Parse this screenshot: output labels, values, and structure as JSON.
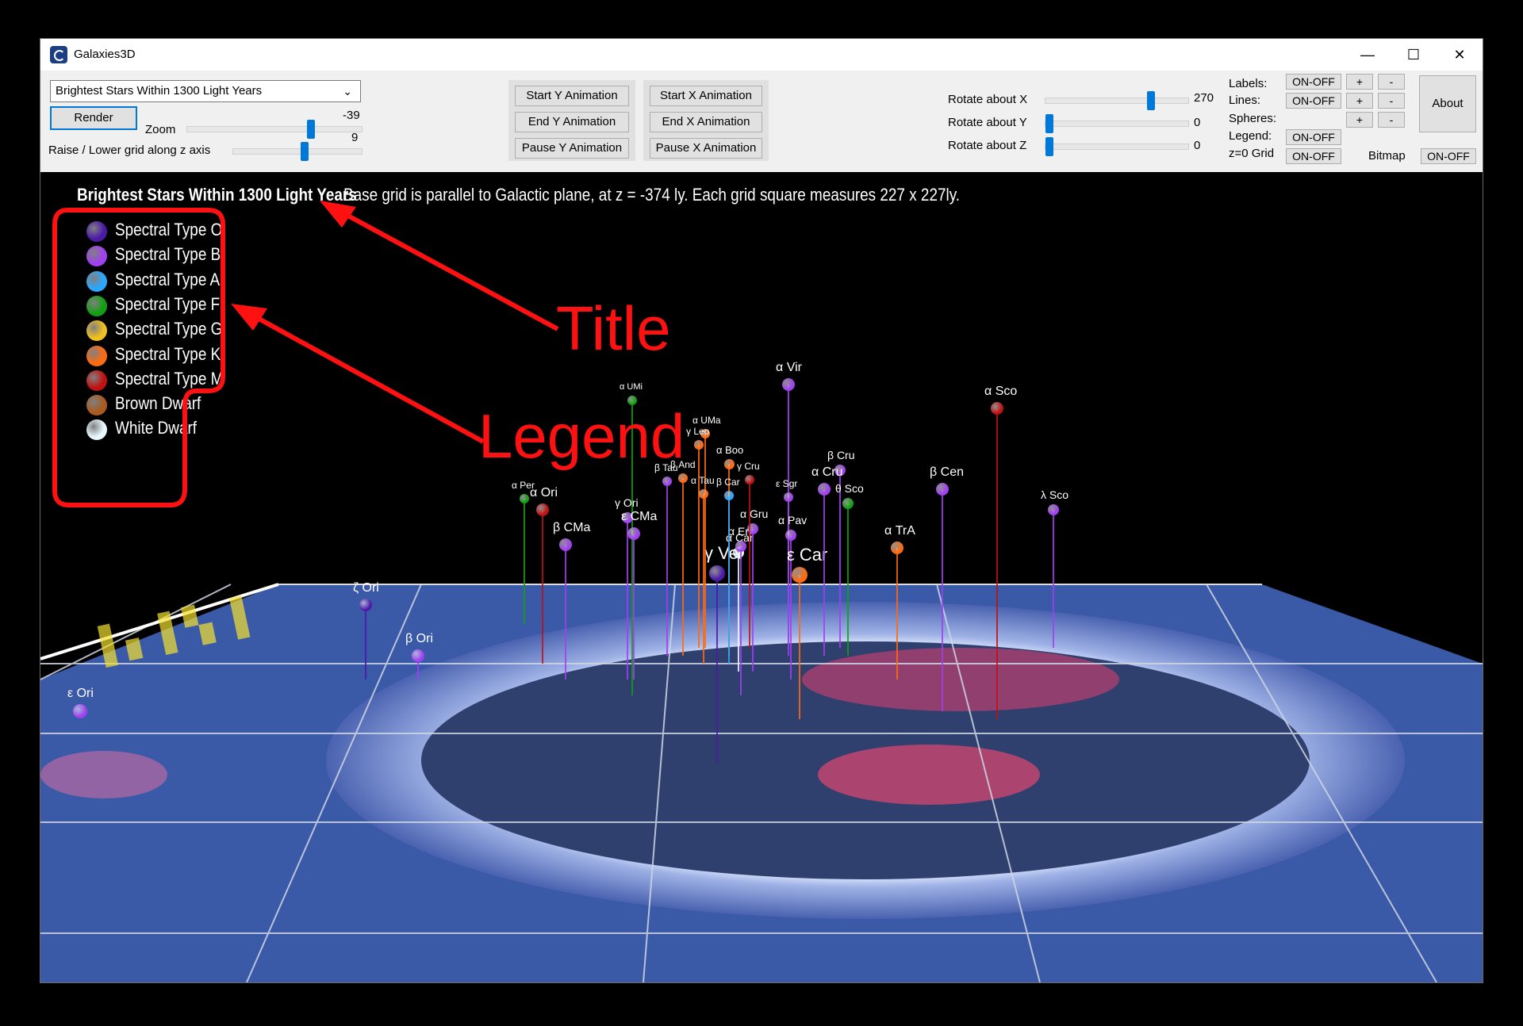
{
  "window": {
    "title": "Galaxies3D",
    "minimize": "—",
    "maximize": "☐",
    "close": "✕"
  },
  "toolbar": {
    "dataset": "Brightest Stars Within 1300 Light Years",
    "render": "Render",
    "zoom_label": "Zoom",
    "zoom_value": "-39",
    "zoom_fraction": 0.72,
    "grid_label": "Raise / Lower grid along z axis",
    "grid_value": "9",
    "grid_fraction": 0.56,
    "y_anim": [
      "Start Y Animation",
      "End Y Animation",
      "Pause Y Animation"
    ],
    "x_anim": [
      "Start X Animation",
      "End X Animation",
      "Pause X Animation"
    ],
    "rotate": [
      {
        "label": "Rotate about X",
        "value": "270",
        "fraction": 0.75
      },
      {
        "label": "Rotate about Y",
        "value": "0",
        "fraction": 0.0
      },
      {
        "label": "Rotate about Z",
        "value": "0",
        "fraction": 0.0
      }
    ],
    "labels_label": "Labels:",
    "lines_label": "Lines:",
    "spheres_label": "Spheres:",
    "legend_label": "Legend:",
    "grid0_label": "z=0 Grid",
    "bitmap_label": "Bitmap",
    "on_off": "ON-OFF",
    "plus": "+",
    "minus": "-",
    "about": "About"
  },
  "scene": {
    "title": "Brightest Stars Within 1300 Light Years",
    "description": "Base grid is parallel to Galactic plane, at z = -374 ly. Each grid square measures 227 x 227ly.",
    "legend": [
      {
        "label": "Spectral Type O",
        "color": "#4b1aa8"
      },
      {
        "label": "Spectral Type B",
        "color": "#a040f0"
      },
      {
        "label": "Spectral Type A",
        "color": "#2aa8ff"
      },
      {
        "label": "Spectral Type F",
        "color": "#12a012"
      },
      {
        "label": "Spectral Type G",
        "color": "#f0c020"
      },
      {
        "label": "Spectral Type K",
        "color": "#ff6a10"
      },
      {
        "label": "Spectral Type M",
        "color": "#c01010"
      },
      {
        "label": "Brown Dwarf",
        "color": "#a85a20"
      },
      {
        "label": "White Dwarf",
        "color": "#e8f8ff"
      }
    ],
    "annotations": {
      "title": "Title",
      "legend": "Legend"
    },
    "stars": [
      {
        "name": "α UMi",
        "color": "#12a012"
      },
      {
        "name": "α Vir",
        "color": "#a040f0"
      },
      {
        "name": "α Sco",
        "color": "#c01010"
      },
      {
        "name": "α Per",
        "color": "#12a012"
      },
      {
        "name": "α Ori",
        "color": "#c01010"
      },
      {
        "name": "β CMa",
        "color": "#a040f0"
      },
      {
        "name": "γ Ori",
        "color": "#a040f0"
      },
      {
        "name": "ε CMa",
        "color": "#a040f0"
      },
      {
        "name": "β Tau",
        "color": "#a040f0"
      },
      {
        "name": "α Car",
        "color": "#e8f8ff"
      },
      {
        "name": "γ Vel",
        "color": "#4b1aa8"
      },
      {
        "name": "α Gru",
        "color": "#a040f0"
      },
      {
        "name": "α Eri",
        "color": "#a040f0"
      },
      {
        "name": "ε Sgr",
        "color": "#a040f0"
      },
      {
        "name": "α Pav",
        "color": "#a040f0"
      },
      {
        "name": "ε Car",
        "color": "#ff6a10"
      },
      {
        "name": "β Cru",
        "color": "#a040f0"
      },
      {
        "name": "α Cru",
        "color": "#a040f0"
      },
      {
        "name": "θ Sco",
        "color": "#12a012"
      },
      {
        "name": "α TrA",
        "color": "#ff6a10"
      },
      {
        "name": "β Cen",
        "color": "#a040f0"
      },
      {
        "name": "λ Sco",
        "color": "#a040f0"
      },
      {
        "name": "ζ Ori",
        "color": "#4b1aa8"
      },
      {
        "name": "β Ori",
        "color": "#a040f0"
      },
      {
        "name": "ε Ori",
        "color": "#a040f0"
      },
      {
        "name": "α Boo",
        "color": "#ff6a10"
      },
      {
        "name": "γ Cru",
        "color": "#c01010"
      },
      {
        "name": "α UMa",
        "color": "#ff6a10"
      },
      {
        "name": "γ Leo",
        "color": "#ff6a10"
      },
      {
        "name": "β And",
        "color": "#ff6a10"
      },
      {
        "name": "α Tau",
        "color": "#ff6a10"
      },
      {
        "name": "β Car",
        "color": "#2aa8ff"
      }
    ]
  }
}
